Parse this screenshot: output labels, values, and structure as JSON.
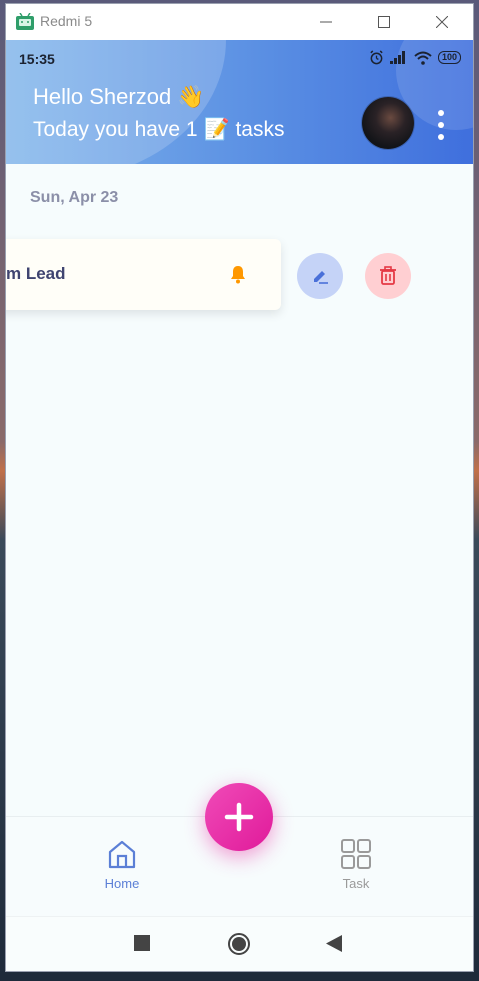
{
  "window": {
    "title": "Redmi 5"
  },
  "status_bar": {
    "time": "15:35",
    "battery": "100"
  },
  "header": {
    "greeting_prefix": "Hello Sherzod",
    "greeting_emoji": "👋",
    "tasks_prefix": "Today you have 1",
    "tasks_emoji": "📝",
    "tasks_suffix": "tasks"
  },
  "date_label": "Sun, Apr 23",
  "tasks": [
    {
      "title": "Team Lead",
      "visible_title": "m Lead"
    }
  ],
  "nav": {
    "home_label": "Home",
    "task_label": "Task"
  },
  "colors": {
    "header_start": "#7fb4ea",
    "header_end": "#3f6fdd",
    "fab": "#e01a9a",
    "active_nav": "#5b7fd6",
    "inactive_nav": "#9a9a9a",
    "bell": "#ff9800",
    "delete": "#e53945"
  }
}
